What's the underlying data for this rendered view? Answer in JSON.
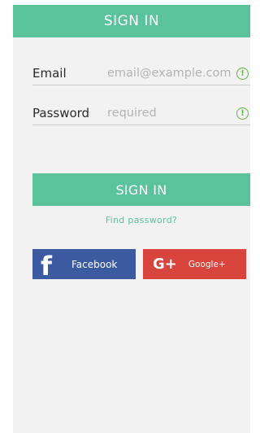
{
  "header": {
    "title": "SIGN IN"
  },
  "form": {
    "email": {
      "label": "Email",
      "placeholder": "email@example.com",
      "icon": "warning-circle-icon"
    },
    "password": {
      "label": "Password",
      "placeholder": "required",
      "icon": "warning-circle-icon"
    }
  },
  "actions": {
    "signin_label": "SIGN IN",
    "find_password": "Find password?"
  },
  "social": {
    "facebook": {
      "label": "Facebook",
      "icon": "facebook-icon",
      "color": "#3b5aa0"
    },
    "google": {
      "label": "Google+",
      "icon": "google-plus-icon",
      "color": "#d9453c"
    }
  },
  "colors": {
    "accent": "#5bc39c",
    "warning": "#5fb340"
  }
}
